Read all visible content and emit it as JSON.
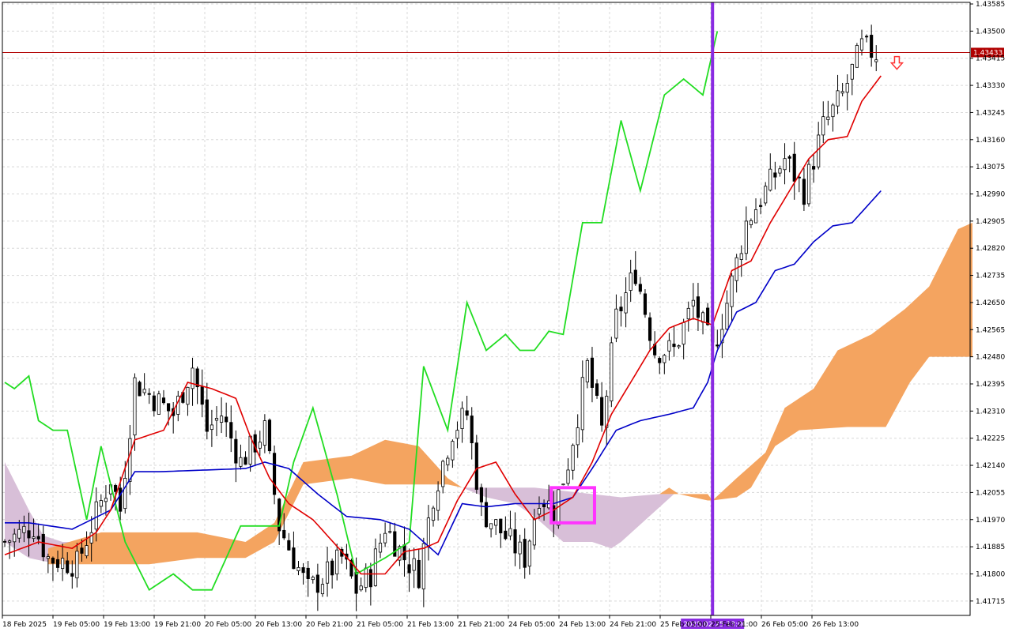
{
  "colors": {
    "background": "#ffffff",
    "grid": "#d8d8d8",
    "axis": "#000000",
    "bull_body": "#ffffff",
    "bear_body": "#000000",
    "wick": "#000000",
    "tenkan": "#e00000",
    "kijun": "#0000c8",
    "chikou": "#22dd22",
    "cloud_bull": "#f4a460",
    "cloud_bear": "#d8bfd8",
    "price_line": "#b00000",
    "price_tag": "#b00000",
    "vline": "#8a2be2",
    "vline_tag": "#8a2be2",
    "highlight_box": "#ff33ff",
    "arrow": "#ff3333"
  },
  "icons": {
    "signal": "down-arrow-icon"
  },
  "chart_data": {
    "type": "candlestick",
    "indicator": "ichimoku",
    "ylim": [
      1.4167,
      1.4359
    ],
    "y_ticks": [
      "1.43585",
      "1.43500",
      "1.43415",
      "1.43330",
      "1.43245",
      "1.43160",
      "1.43075",
      "1.42990",
      "1.42905",
      "1.42820",
      "1.42735",
      "1.42650",
      "1.42565",
      "1.42480",
      "1.42395",
      "1.42310",
      "1.42225",
      "1.42140",
      "1.42055",
      "1.41970",
      "1.41885",
      "1.41800",
      "1.41715"
    ],
    "x_ticks": [
      "18 Feb 2025",
      "19 Feb 05:00",
      "19 Feb 13:00",
      "19 Feb 21:00",
      "20 Feb 05:00",
      "20 Feb 13:00",
      "20 Feb 21:00",
      "21 Feb 05:00",
      "21 Feb 13:00",
      "21 Feb 21:00",
      "24 Feb 05:00",
      "24 Feb 13:00",
      "24 Feb 21:00",
      "25 Feb 05:00",
      "25 Feb 21:00",
      "26 Feb 05:00",
      "26 Feb 13:00"
    ],
    "current_price": "1.43433",
    "current_price_value": 1.43433,
    "vline_label": "2025.02.25 13:00",
    "vline_bar": 147,
    "highlight": {
      "bar_start": 114,
      "bar_end": 122,
      "y_top": 1.4207,
      "y_bottom": 1.4196
    },
    "signal_arrow": {
      "bar": 183,
      "price": 1.4343
    },
    "bars_total": 201,
    "candles_close_anchors": [
      [
        0,
        1.419
      ],
      [
        6,
        1.4195
      ],
      [
        9,
        1.4185
      ],
      [
        15,
        1.4183
      ],
      [
        18,
        1.4195
      ],
      [
        22,
        1.421
      ],
      [
        24,
        1.42
      ],
      [
        27,
        1.424
      ],
      [
        31,
        1.4235
      ],
      [
        35,
        1.423
      ],
      [
        39,
        1.4245
      ],
      [
        42,
        1.4225
      ],
      [
        45,
        1.423
      ],
      [
        49,
        1.4215
      ],
      [
        54,
        1.4225
      ],
      [
        57,
        1.4195
      ],
      [
        60,
        1.4185
      ],
      [
        63,
        1.4175
      ],
      [
        67,
        1.418
      ],
      [
        70,
        1.4185
      ],
      [
        73,
        1.4175
      ],
      [
        76,
        1.418
      ],
      [
        79,
        1.4195
      ],
      [
        83,
        1.4185
      ],
      [
        86,
        1.418
      ],
      [
        89,
        1.4205
      ],
      [
        93,
        1.4225
      ],
      [
        96,
        1.423
      ],
      [
        99,
        1.42
      ],
      [
        102,
        1.4195
      ],
      [
        105,
        1.419
      ],
      [
        108,
        1.4185
      ],
      [
        111,
        1.4205
      ],
      [
        114,
        1.42
      ],
      [
        117,
        1.4215
      ],
      [
        121,
        1.4245
      ],
      [
        124,
        1.4225
      ],
      [
        127,
        1.426
      ],
      [
        131,
        1.4275
      ],
      [
        135,
        1.425
      ],
      [
        139,
        1.425
      ],
      [
        143,
        1.4265
      ],
      [
        147,
        1.425
      ],
      [
        150,
        1.4265
      ],
      [
        154,
        1.429
      ],
      [
        158,
        1.43
      ],
      [
        162,
        1.431
      ],
      [
        166,
        1.43
      ],
      [
        170,
        1.432
      ],
      [
        174,
        1.433
      ],
      [
        178,
        1.4345
      ],
      [
        181,
        1.4343
      ]
    ],
    "tenkan_anchors": [
      [
        0,
        1.4186
      ],
      [
        7,
        1.419
      ],
      [
        14,
        1.4188
      ],
      [
        19,
        1.4193
      ],
      [
        22,
        1.42
      ],
      [
        27,
        1.4222
      ],
      [
        33,
        1.4225
      ],
      [
        38,
        1.424
      ],
      [
        43,
        1.4238
      ],
      [
        48,
        1.4235
      ],
      [
        51,
        1.4223
      ],
      [
        55,
        1.421
      ],
      [
        59,
        1.4202
      ],
      [
        64,
        1.4197
      ],
      [
        70,
        1.4187
      ],
      [
        74,
        1.418
      ],
      [
        79,
        1.418
      ],
      [
        83,
        1.4187
      ],
      [
        87,
        1.4188
      ],
      [
        90,
        1.419
      ],
      [
        94,
        1.4203
      ],
      [
        98,
        1.4213
      ],
      [
        102,
        1.4215
      ],
      [
        106,
        1.4205
      ],
      [
        110,
        1.4197
      ],
      [
        114,
        1.42
      ],
      [
        118,
        1.4204
      ],
      [
        122,
        1.4215
      ],
      [
        126,
        1.423
      ],
      [
        130,
        1.424
      ],
      [
        134,
        1.425
      ],
      [
        138,
        1.4257
      ],
      [
        143,
        1.426
      ],
      [
        147,
        1.4258
      ],
      [
        151,
        1.4275
      ],
      [
        155,
        1.4278
      ],
      [
        159,
        1.429
      ],
      [
        163,
        1.43
      ],
      [
        167,
        1.431
      ],
      [
        171,
        1.4316
      ],
      [
        175,
        1.4317
      ],
      [
        178,
        1.4328
      ],
      [
        182,
        1.4336
      ]
    ],
    "kijun_anchors": [
      [
        0,
        1.4196
      ],
      [
        5,
        1.4196
      ],
      [
        14,
        1.4194
      ],
      [
        22,
        1.42
      ],
      [
        27,
        1.4212
      ],
      [
        32,
        1.4212
      ],
      [
        50,
        1.4213
      ],
      [
        54,
        1.4215
      ],
      [
        59,
        1.4213
      ],
      [
        65,
        1.4205
      ],
      [
        71,
        1.4198
      ],
      [
        78,
        1.4197
      ],
      [
        84,
        1.4194
      ],
      [
        90,
        1.4186
      ],
      [
        95,
        1.4202
      ],
      [
        100,
        1.4201
      ],
      [
        106,
        1.4202
      ],
      [
        114,
        1.4202
      ],
      [
        118,
        1.4204
      ],
      [
        122,
        1.4213
      ],
      [
        127,
        1.4225
      ],
      [
        132,
        1.4228
      ],
      [
        138,
        1.423
      ],
      [
        143,
        1.4232
      ],
      [
        146,
        1.424
      ],
      [
        148,
        1.425
      ],
      [
        152,
        1.4262
      ],
      [
        156,
        1.4265
      ],
      [
        160,
        1.4275
      ],
      [
        164,
        1.4277
      ],
      [
        168,
        1.4284
      ],
      [
        172,
        1.4289
      ],
      [
        176,
        1.429
      ],
      [
        179,
        1.4295
      ],
      [
        182,
        1.43
      ]
    ],
    "chikou_anchors": [
      [
        0,
        1.424
      ],
      [
        2,
        1.4238
      ],
      [
        5,
        1.4242
      ],
      [
        7,
        1.4228
      ],
      [
        10,
        1.4225
      ],
      [
        13,
        1.4225
      ],
      [
        17,
        1.4197
      ],
      [
        20,
        1.422
      ],
      [
        25,
        1.419
      ],
      [
        30,
        1.4175
      ],
      [
        35,
        1.418
      ],
      [
        39,
        1.4175
      ],
      [
        43,
        1.4175
      ],
      [
        49,
        1.4195
      ],
      [
        53,
        1.4195
      ],
      [
        57,
        1.4195
      ],
      [
        60,
        1.4215
      ],
      [
        64,
        1.4232
      ],
      [
        69,
        1.4205
      ],
      [
        73,
        1.418
      ],
      [
        79,
        1.4185
      ],
      [
        84,
        1.419
      ],
      [
        87,
        1.4245
      ],
      [
        92,
        1.4225
      ],
      [
        96,
        1.4265
      ],
      [
        100,
        1.425
      ],
      [
        104,
        1.4255
      ],
      [
        107,
        1.425
      ],
      [
        110,
        1.425
      ],
      [
        113,
        1.4256
      ],
      [
        116,
        1.4255
      ],
      [
        120,
        1.429
      ],
      [
        124,
        1.429
      ],
      [
        128,
        1.4322
      ],
      [
        132,
        1.43
      ],
      [
        137,
        1.433
      ],
      [
        141,
        1.4335
      ],
      [
        145,
        1.433
      ],
      [
        148,
        1.435
      ]
    ],
    "cloud_segments": [
      {
        "kind": "bear",
        "top": [
          [
            0,
            1.4215
          ],
          [
            5,
            1.42
          ],
          [
            8,
            1.4192
          ],
          [
            12,
            1.419
          ],
          [
            15,
            1.419
          ]
        ],
        "bot": [
          [
            0,
            1.419
          ],
          [
            5,
            1.4185
          ],
          [
            8,
            1.4184
          ],
          [
            12,
            1.4183
          ],
          [
            15,
            1.4183
          ]
        ]
      },
      {
        "kind": "bull",
        "top": [
          [
            9,
            1.4188
          ],
          [
            20,
            1.4193
          ],
          [
            27,
            1.4193
          ],
          [
            40,
            1.4193
          ],
          [
            50,
            1.419
          ],
          [
            56,
            1.4196
          ],
          [
            62,
            1.4215
          ],
          [
            72,
            1.4217
          ],
          [
            79,
            1.4222
          ],
          [
            86,
            1.422
          ],
          [
            92,
            1.421
          ],
          [
            95,
            1.4207
          ]
        ],
        "bot": [
          [
            9,
            1.4183
          ],
          [
            20,
            1.4183
          ],
          [
            30,
            1.4183
          ],
          [
            40,
            1.4185
          ],
          [
            50,
            1.4185
          ],
          [
            56,
            1.419
          ],
          [
            62,
            1.4208
          ],
          [
            72,
            1.421
          ],
          [
            79,
            1.4208
          ],
          [
            86,
            1.4208
          ],
          [
            92,
            1.4208
          ],
          [
            95,
            1.4207
          ]
        ]
      },
      {
        "kind": "bear",
        "top": [
          [
            95,
            1.4207
          ],
          [
            110,
            1.4207
          ],
          [
            122,
            1.4205
          ],
          [
            128,
            1.4204
          ],
          [
            136,
            1.4205
          ],
          [
            139,
            1.4205
          ]
        ],
        "bot": [
          [
            95,
            1.4207
          ],
          [
            100,
            1.4204
          ],
          [
            106,
            1.4202
          ],
          [
            110,
            1.4198
          ],
          [
            116,
            1.419
          ],
          [
            122,
            1.419
          ],
          [
            126,
            1.4188
          ],
          [
            128,
            1.419
          ]
        ]
      },
      {
        "kind": "bull",
        "top": [
          [
            136,
            1.4205
          ],
          [
            138,
            1.4207
          ],
          [
            140,
            1.4205
          ],
          [
            146,
            1.4205
          ],
          [
            147,
            1.4203
          ]
        ],
        "bot": [
          [
            136,
            1.4205
          ],
          [
            140,
            1.4205
          ],
          [
            146,
            1.4203
          ],
          [
            147,
            1.4203
          ]
        ]
      },
      {
        "kind": "bull",
        "top": [
          [
            147,
            1.4203
          ],
          [
            152,
            1.421
          ],
          [
            158,
            1.4218
          ],
          [
            162,
            1.4232
          ],
          [
            168,
            1.4238
          ],
          [
            173,
            1.425
          ],
          [
            180,
            1.4255
          ],
          [
            187,
            1.4263
          ],
          [
            192,
            1.427
          ],
          [
            198,
            1.4288
          ],
          [
            201,
            1.429
          ]
        ],
        "bot": [
          [
            147,
            1.4203
          ],
          [
            152,
            1.4204
          ],
          [
            155,
            1.4207
          ],
          [
            160,
            1.422
          ],
          [
            165,
            1.4225
          ],
          [
            175,
            1.4226
          ],
          [
            183,
            1.4226
          ],
          [
            188,
            1.424
          ],
          [
            192,
            1.4248
          ],
          [
            201,
            1.4248
          ]
        ]
      }
    ]
  }
}
